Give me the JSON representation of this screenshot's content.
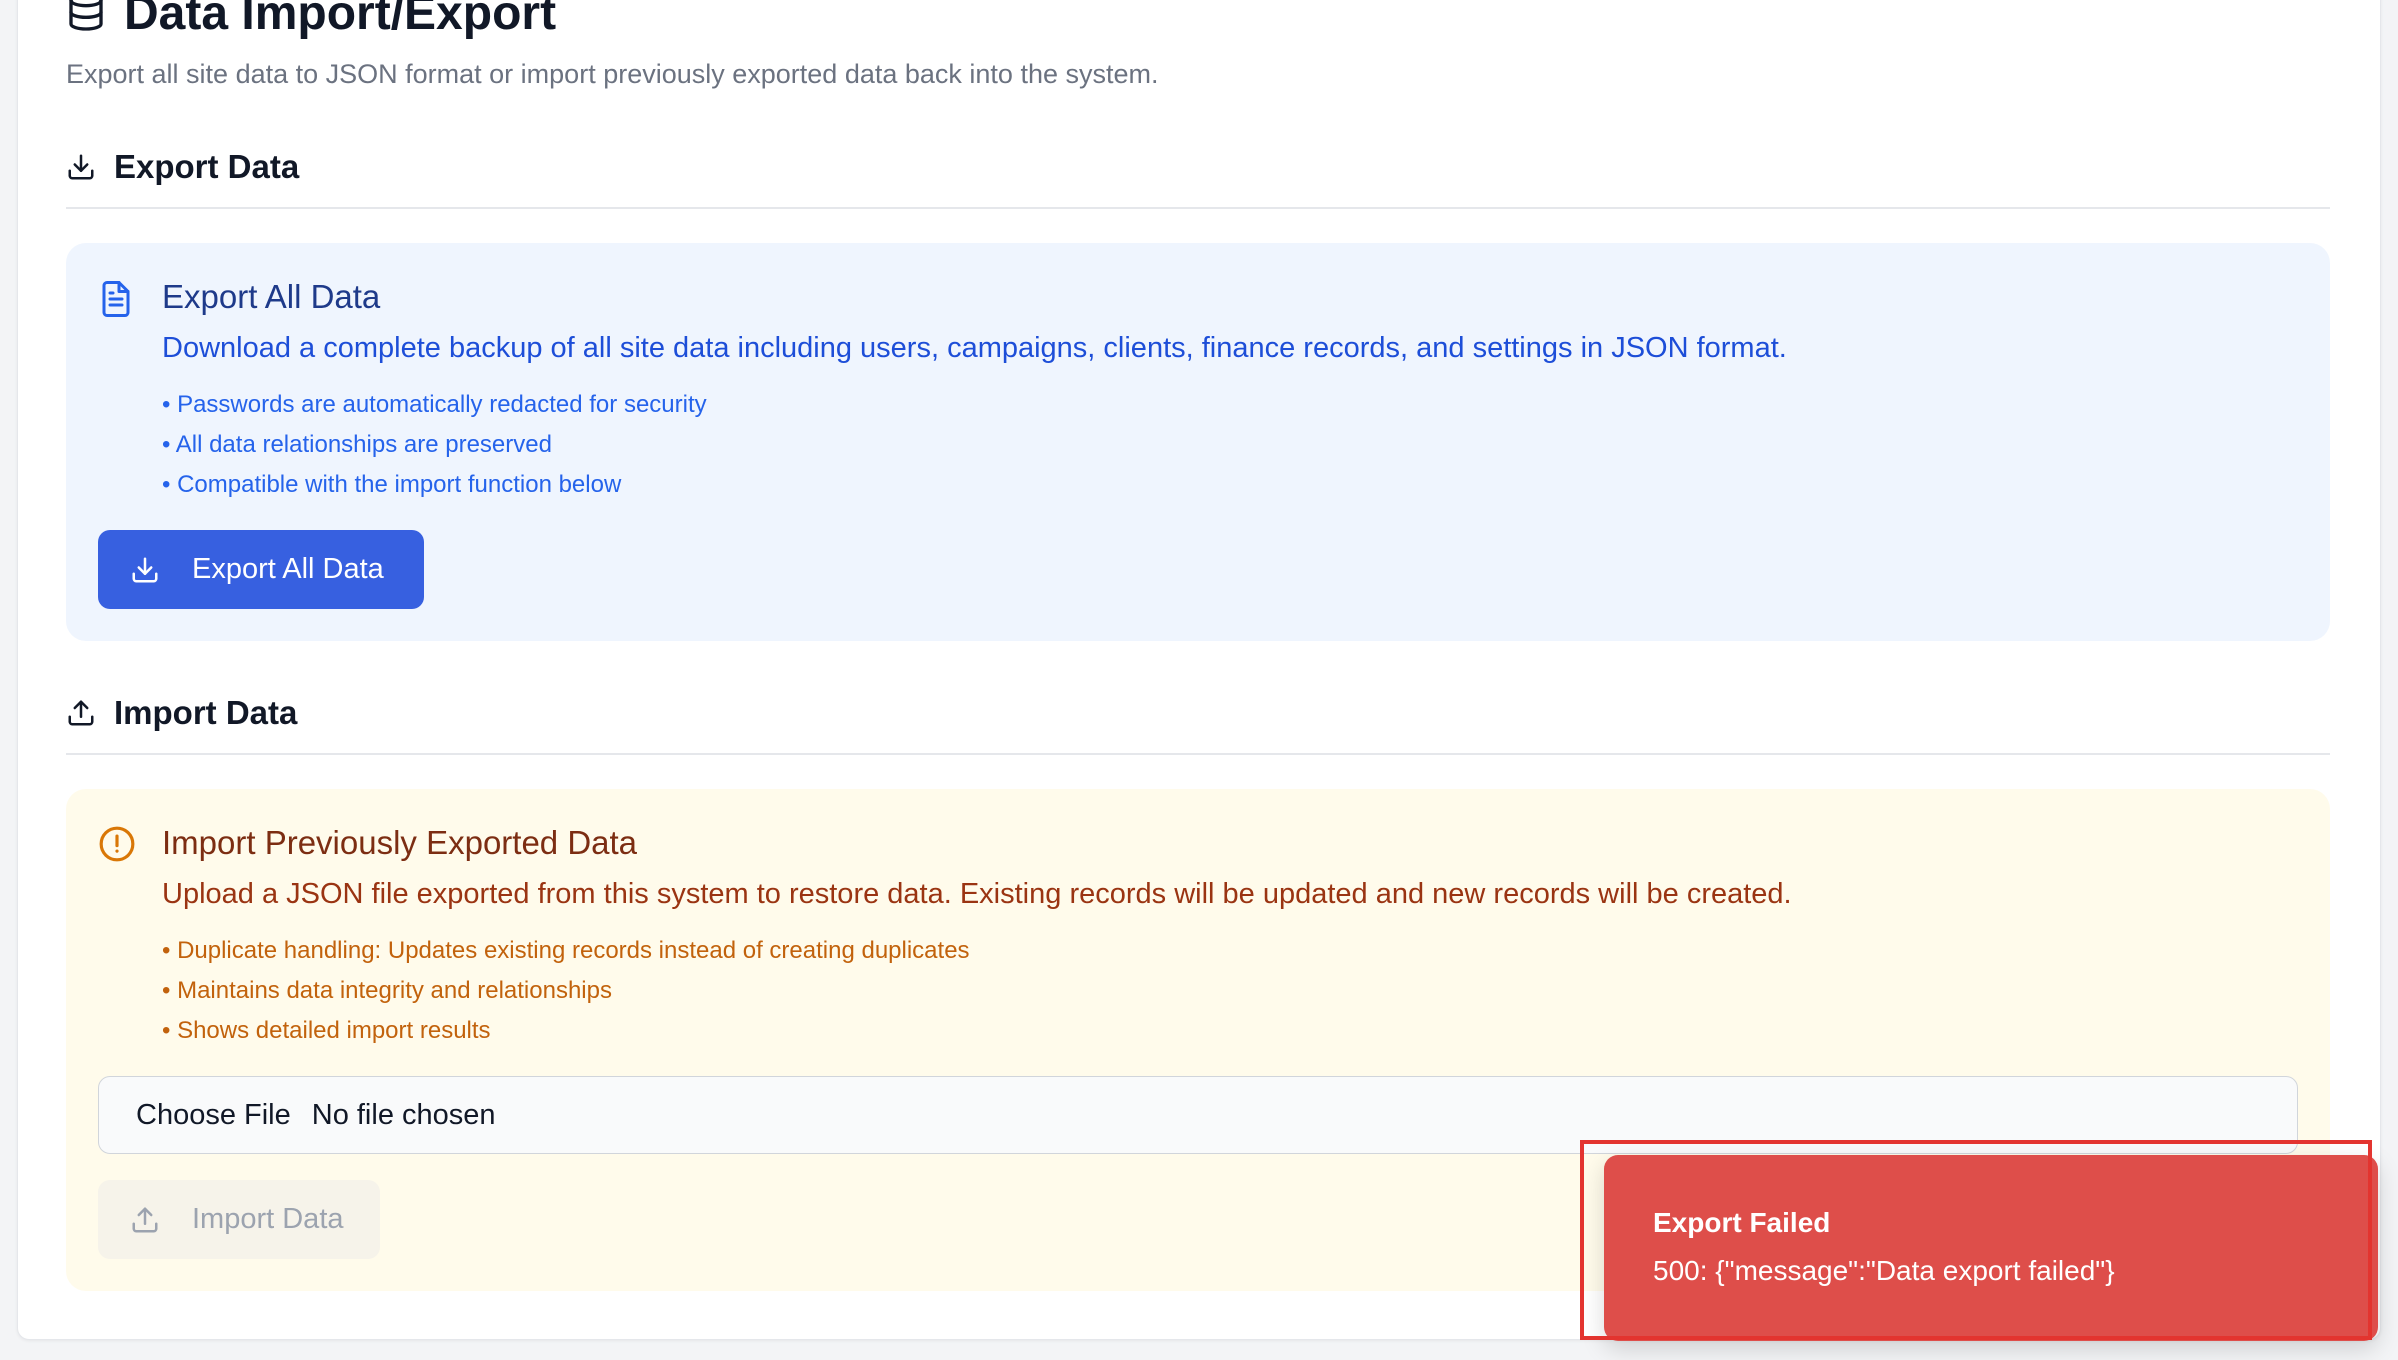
{
  "header": {
    "title": "Data Import/Export",
    "subtitle": "Export all site data to JSON format or import previously exported data back into the system."
  },
  "export_section": {
    "heading": "Export Data",
    "panel": {
      "title": "Export All Data",
      "description": "Download a complete backup of all site data including users, campaigns, clients, finance records, and settings in JSON format.",
      "bullets": [
        "• Passwords are automatically redacted for security",
        "• All data relationships are preserved",
        "• Compatible with the import function below"
      ],
      "button_label": "Export All Data"
    }
  },
  "import_section": {
    "heading": "Import Data",
    "panel": {
      "title": "Import Previously Exported Data",
      "description": "Upload a JSON file exported from this system to restore data. Existing records will be updated and new records will be created.",
      "bullets": [
        "• Duplicate handling: Updates existing records instead of creating duplicates",
        "• Maintains data integrity and relationships",
        "• Shows detailed import results"
      ],
      "file_button_label": "Choose File",
      "file_status": "No file chosen",
      "button_label": "Import Data"
    }
  },
  "toast": {
    "title": "Export Failed",
    "message": "500: {\"message\":\"Data export failed\"}"
  },
  "icons": {
    "title": "database-icon",
    "export_heading": "download-icon",
    "export_panel": "file-text-icon",
    "export_button": "download-icon",
    "import_heading": "upload-icon",
    "import_panel": "alert-circle-icon",
    "import_button": "upload-icon"
  },
  "colors": {
    "primary": "#3760e0",
    "export_panel_bg": "#eff5fe",
    "import_panel_bg": "#fffbeb",
    "toast_bg": "#de4e4a",
    "toast_outline": "#e3342f"
  }
}
